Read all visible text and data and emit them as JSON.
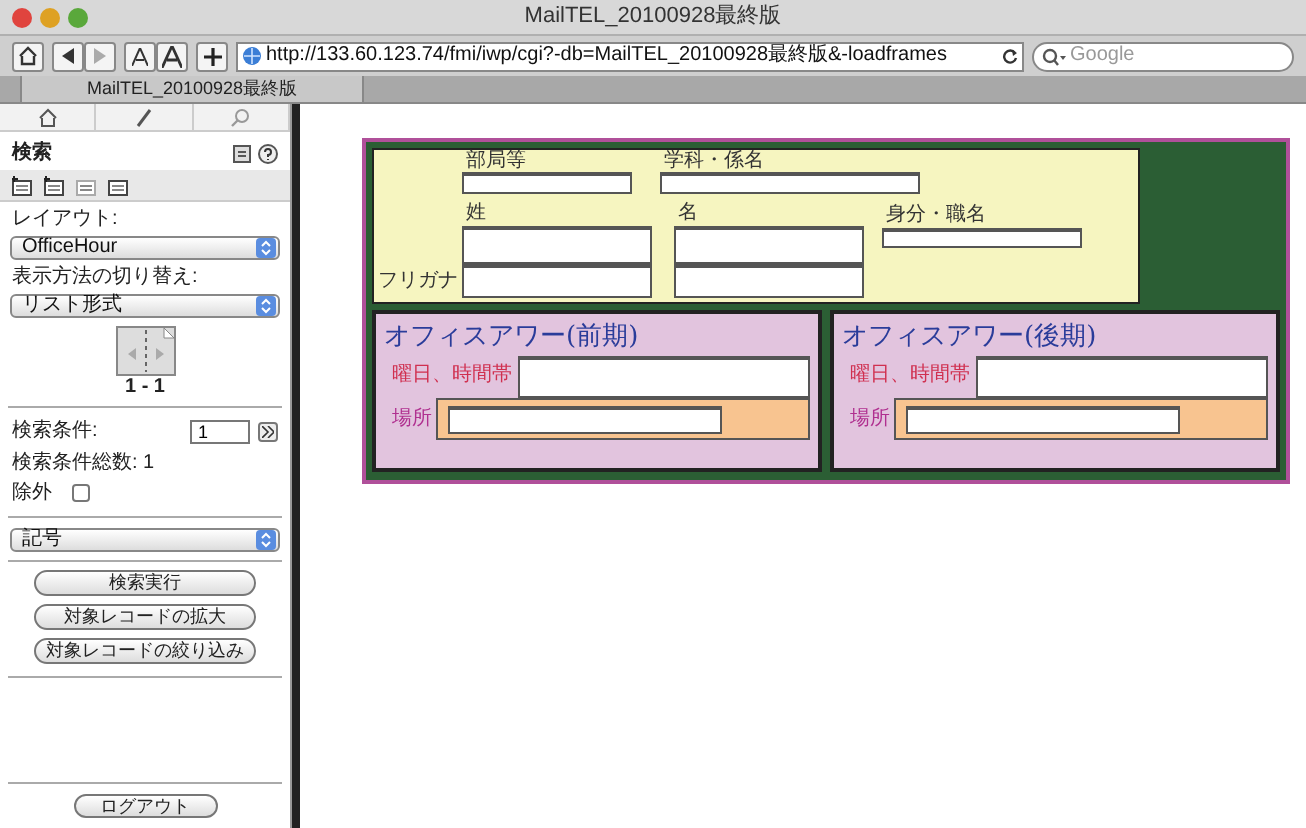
{
  "window": {
    "title": "MailTEL_20100928最終版"
  },
  "toolbar": {
    "url": "http://133.60.123.74/fmi/iwp/cgi?-db=MailTEL_20100928最終版&-loadframes",
    "search_placeholder": "Google"
  },
  "tabs": [
    {
      "label": "MailTEL_20100928最終版",
      "selected": true
    }
  ],
  "sidebar": {
    "title": "検索",
    "layout_label": "レイアウト:",
    "layout_value": "OfficeHour",
    "view_label": "表示方法の切り替え:",
    "view_value": "リスト形式",
    "record_range": "1 - 1",
    "condition_label": "検索条件:",
    "condition_value": "1",
    "condition_count": "検索条件総数: 1",
    "exclude": {
      "label": "除外",
      "checked": false
    },
    "field_select": "記号",
    "buttons": [
      "検索実行",
      "対象レコードの拡大",
      "対象レコードの絞り込み"
    ],
    "logout": "ログアウト"
  },
  "form": {
    "top_fields": [
      {
        "label": "部局等"
      },
      {
        "label": "学科・係名"
      }
    ],
    "furigana_label": "フリガナ",
    "name_fields": [
      {
        "label": "姓"
      },
      {
        "label": "名"
      }
    ],
    "title_field": {
      "label": "身分・職名"
    },
    "sections": [
      {
        "title": "オフィスアワー(前期)",
        "time_label": "曜日、時間帯",
        "place_label": "場所"
      },
      {
        "title": "オフィスアワー(後期)",
        "time_label": "曜日、時間帯",
        "place_label": "場所"
      }
    ]
  }
}
